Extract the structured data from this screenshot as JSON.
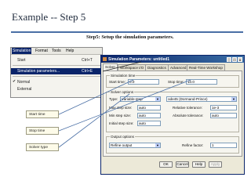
{
  "slide": {
    "title": "Example -- Step 5",
    "subtitle": "Step5: Setup the simulation parameters."
  },
  "menu": {
    "bar": [
      "Simulation",
      "Format",
      "Tools",
      "Help"
    ],
    "items": [
      {
        "label": "Start",
        "shortcut": "Ctrl+T"
      },
      {
        "label": "Simulation parameters...",
        "shortcut": "Ctrl+E"
      },
      {
        "label": "Normal",
        "checked": true
      },
      {
        "label": "External"
      }
    ]
  },
  "dialog": {
    "title": "Simulation Parameters: untitled1",
    "tabs": [
      "Solver",
      "Workspace I/O",
      "Diagnostics",
      "Advanced",
      "Real-Time Workshop"
    ],
    "active_tab": "Solver",
    "simulation_time": {
      "group_label": "Simulation time",
      "start_label": "Start time:",
      "start_value": "0.0",
      "stop_label": "Stop time:",
      "stop_value": "10.0"
    },
    "solver_options": {
      "group_label": "Solver options",
      "type_label": "Type:",
      "type_value": "Variable-step",
      "solver_value": "ode45 (Dormand-Prince)",
      "max_step_label": "Max step size:",
      "max_step_value": "auto",
      "rel_tol_label": "Relative tolerance:",
      "rel_tol_value": "1e-3",
      "min_step_label": "Min step size:",
      "min_step_value": "auto",
      "abs_tol_label": "Absolute tolerance:",
      "abs_tol_value": "auto",
      "init_step_label": "Initial step size:",
      "init_step_value": "auto"
    },
    "output_options": {
      "group_label": "Output options",
      "output_value": "Refine output",
      "refine_label": "Refine factor:",
      "refine_value": "1"
    },
    "buttons": [
      "OK",
      "Cancel",
      "Help",
      "Apply"
    ]
  },
  "callouts": [
    "Start time",
    "Stop time",
    "Solver type"
  ],
  "colors": {
    "menu_highlight": "#0a246a",
    "title_bar": "#0a246a",
    "callout_bg": "#fdfbe9",
    "rule": "#4a6fa5"
  }
}
